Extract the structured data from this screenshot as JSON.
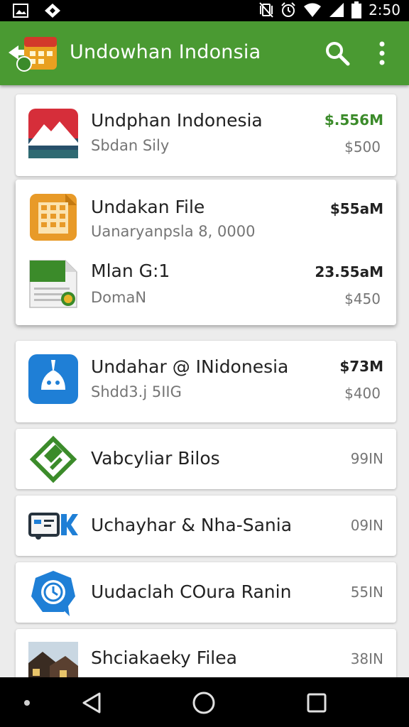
{
  "status_bar": {
    "time": "2:50",
    "left_icons": [
      "photo-icon",
      "notification-icon"
    ],
    "right_icons": [
      "vibrate-icon",
      "alarm-icon",
      "wifi-icon",
      "signal-icon",
      "battery-icon"
    ]
  },
  "app_bar": {
    "title": "Undowhan Indonsia",
    "color": "#4a9a32"
  },
  "items": [
    {
      "name": "Undphan Indonesia",
      "subtitle": "Sbdan Sily",
      "value": "$.556M",
      "price": "$500",
      "icon": "mountain-flag-icon"
    },
    {
      "name": "Undakan File",
      "subtitle": "Uanaryanpsla 8, 0000",
      "value": "$55aM",
      "icon": "spreadsheet-icon"
    },
    {
      "name": "Mlan G:1",
      "subtitle": "DomaN",
      "value": "23.55aM",
      "price": "$450",
      "icon": "document-chart-icon"
    },
    {
      "name": "Undahar @ INidonesia",
      "subtitle": "Shdd3.j 5IIG",
      "value": "$73M",
      "price": "$400",
      "icon": "blue-app-icon"
    },
    {
      "name": "Vabcyliar Bilos",
      "size": "99IN",
      "icon": "green-diamond-icon"
    },
    {
      "name": "Uchayhar & Nha-Sania",
      "size": "09IN",
      "icon": "card-k-icon"
    },
    {
      "name": "Uudaclah COura Ranin",
      "size": "55IN",
      "icon": "chat-clock-icon"
    },
    {
      "name": "Shciakaeky Filea",
      "size": "38IN",
      "icon": "house-photo-icon"
    }
  ]
}
